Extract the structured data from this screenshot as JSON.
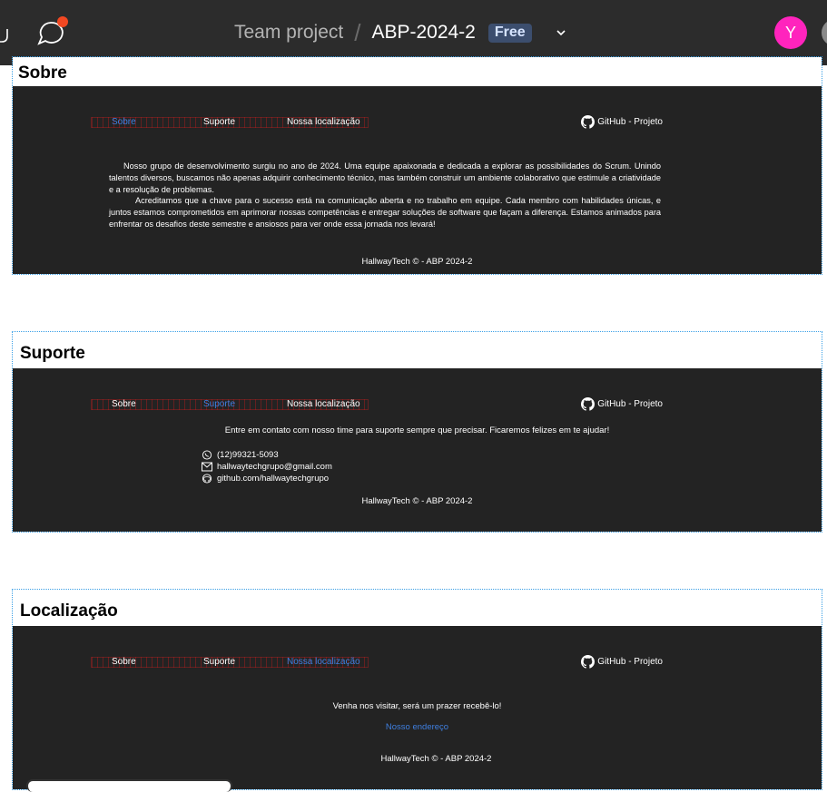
{
  "topbar": {
    "team": "Team project",
    "separator": "/",
    "file_name": "ABP-2024-2",
    "plan_badge": "Free",
    "avatar_initial": "Y",
    "icons": [
      "hand-icon",
      "comment-icon",
      "chevron-down-icon"
    ],
    "notification_color": "#f24822",
    "avatar_color": "#ff24bd"
  },
  "site": {
    "nav": {
      "sobre": "Sobre",
      "suporte": "Suporte",
      "localizacao": "Nossa localização"
    },
    "github_link": "GitHub - Projeto",
    "footer": "HallwayTech © - ABP 2024-2",
    "background": "#232323",
    "accent": "#3f7fe0"
  },
  "frames": {
    "sobre": {
      "title": "Sobre",
      "paragraph1": "Nosso grupo de desenvolvimento surgiu no ano de 2024. Uma equipe apaixonada e dedicada a explorar as possibilidades do Scrum. Unindo talentos diversos, buscamos não apenas adquirir conhecimento técnico, mas também construir um ambiente colaborativo que estimule a criatividade e a resolução de problemas.",
      "paragraph2": "Acreditamos que a chave para o sucesso está na comunicação aberta e no trabalho em equipe. Cada membro com habilidades únicas, e juntos estamos comprometidos em aprimorar nossas competências e entregar soluções de software que façam a diferença. Estamos animados para enfrentar os desafios deste semestre e ansiosos para ver onde essa jornada nos levará!"
    },
    "suporte": {
      "title": "Suporte",
      "intro": "Entre em contato com nosso time para suporte sempre que precisar. Ficaremos felizes em te ajudar!",
      "phone": "(12)99321-5093",
      "email": "hallwaytechgrupo@gmail.com",
      "github": "github.com/hallwaytechgrupo"
    },
    "localizacao": {
      "title": "Localização",
      "intro": "Venha nos visitar, será um prazer recebê-lo!",
      "address_link": "Nosso endereço"
    }
  }
}
